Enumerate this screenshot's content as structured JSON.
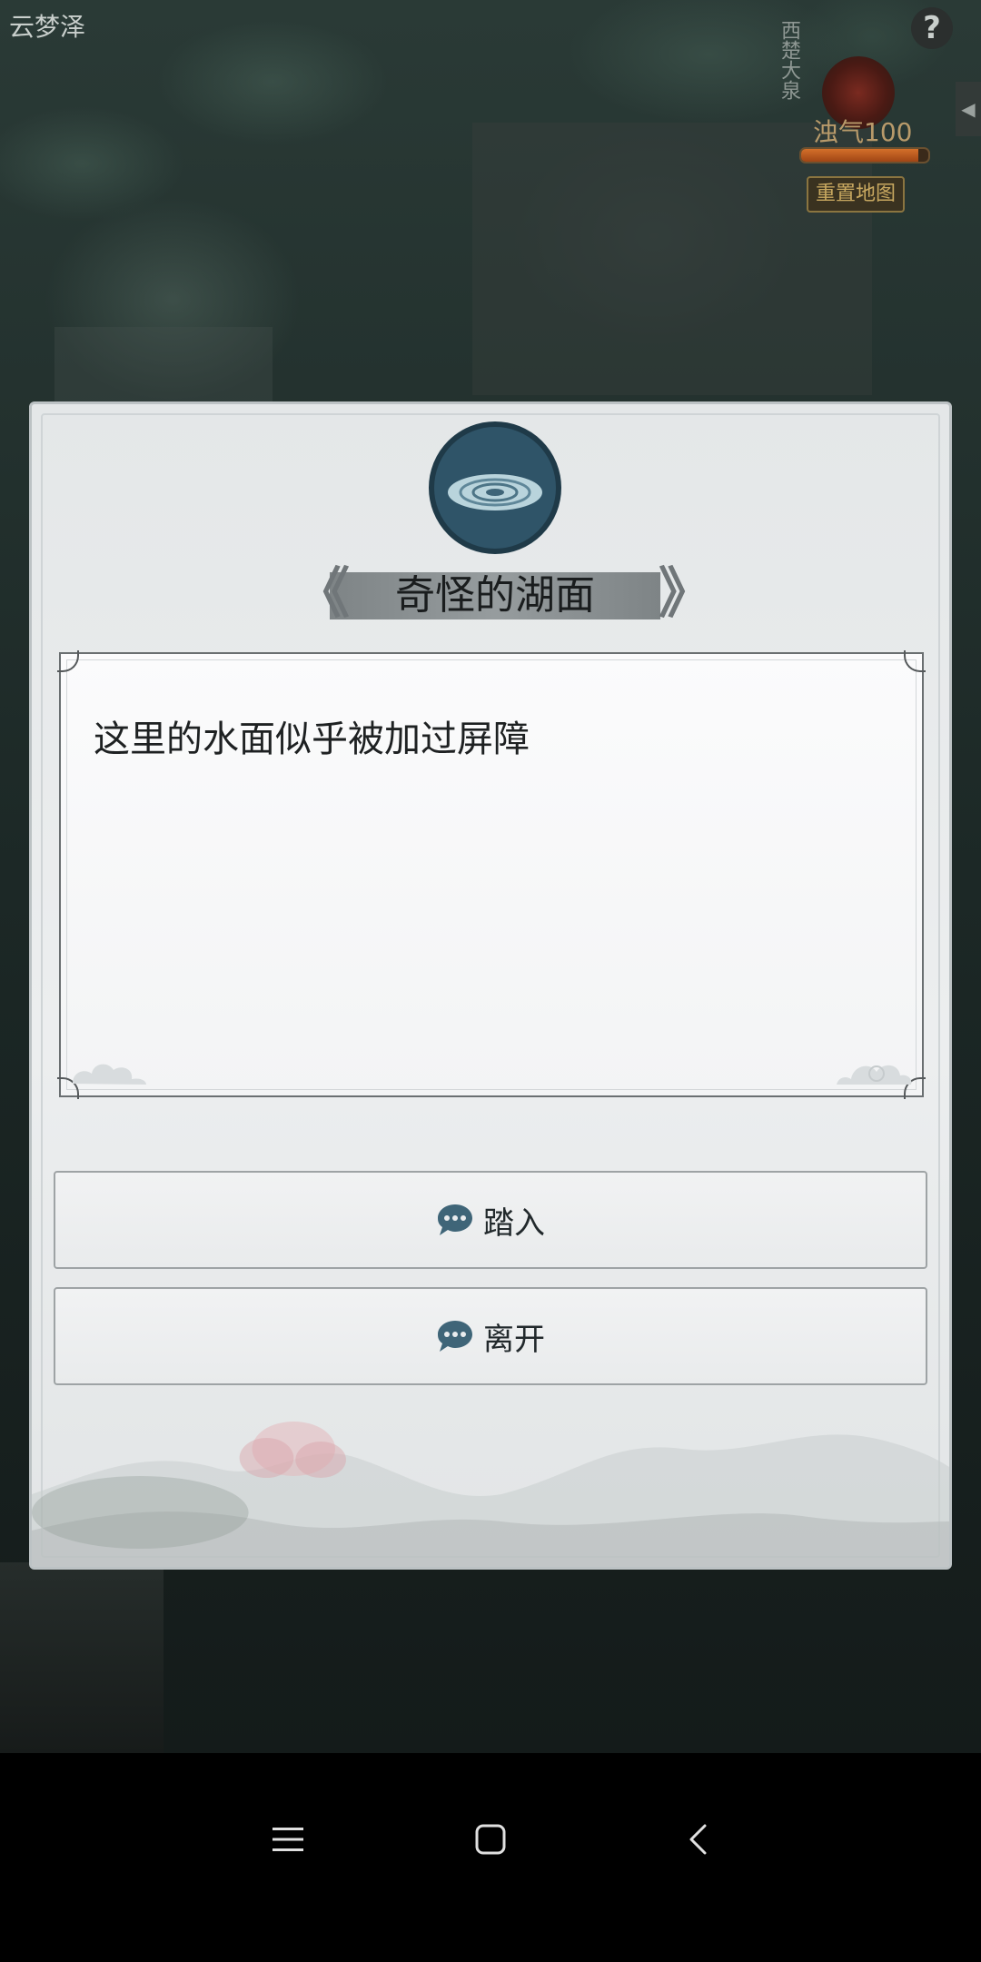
{
  "hud": {
    "area_name": "云梦泽",
    "help_label": "?",
    "side_tab_label": "◀",
    "vertical_inscription": "西楚大泉",
    "turbid_label": "浊气100",
    "turbid_value": 100,
    "turbid_fill_fraction": 0.92,
    "reset_map_label": "重置地图"
  },
  "dialog": {
    "title": "奇怪的湖面",
    "title_left_ornament": "《",
    "title_right_ornament": "》",
    "description": "这里的水面似乎被加过屏障",
    "choices": [
      {
        "label": "踏入"
      },
      {
        "label": "离开"
      }
    ]
  },
  "colors": {
    "accent_icon": "#3f6578",
    "dialog_bg": "#e8eaeb",
    "title_banner": "#8a9092"
  },
  "icons": {
    "event_icon": "water-ripple-icon",
    "choice_icon": "chat-bubble-icon",
    "nav": [
      "menu-icon",
      "home-square-icon",
      "back-chevron-icon"
    ]
  }
}
